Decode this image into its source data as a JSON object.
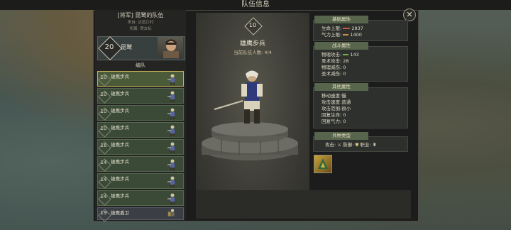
{
  "window": {
    "title": "队伍信息"
  },
  "team": {
    "name": "[将军] 昆鹫的队伍",
    "origin": "来自: 达道口村",
    "belongs": "所属: 鸢去标"
  },
  "leader": {
    "level": "20",
    "name": "昆鹫"
  },
  "formation_label": "编队",
  "units": [
    {
      "level": "10",
      "name": "雄鹰步兵"
    },
    {
      "level": "10",
      "name": "雄鹰步兵"
    },
    {
      "level": "10",
      "name": "雄鹰步兵"
    },
    {
      "level": "10",
      "name": "雄鹰步兵"
    },
    {
      "level": "16",
      "name": "雄鹰步兵"
    },
    {
      "level": "14",
      "name": "雄鹰步兵"
    },
    {
      "level": "14",
      "name": "雄鹰步兵"
    },
    {
      "level": "14",
      "name": "雄鹰步兵"
    },
    {
      "level": "19",
      "name": "雄鹰盾卫"
    }
  ],
  "selected_unit": {
    "level": "10",
    "name": "雄鹰步兵",
    "count": "当前队伍人数: 4/4"
  },
  "basic": {
    "header": "基础属性",
    "hp_label": "生命上限",
    "hp_value": "2837",
    "qi_label": "气力上限",
    "qi_value": "1400"
  },
  "combat": {
    "header": "战斗属性",
    "lines": [
      {
        "label": "物理攻击",
        "value": "143"
      },
      {
        "label": "圣术攻击",
        "value": "28"
      },
      {
        "label": "物理减伤",
        "value": "0"
      },
      {
        "label": "圣术减伤",
        "value": "0"
      }
    ]
  },
  "other": {
    "header": "其他属性",
    "lines": [
      {
        "label": "移动速度",
        "value": "慢"
      },
      {
        "label": "攻击速度",
        "value": "普通"
      },
      {
        "label": "攻击范围",
        "value": "很小"
      },
      {
        "label": "回复生命",
        "value": "0"
      },
      {
        "label": "回复气力",
        "value": "0"
      }
    ]
  },
  "traits": {
    "header": "兵种类型",
    "attack_label": "攻击:",
    "defense_label": "防御:",
    "job_label": "职业:"
  },
  "colors": {
    "accent": "#56654c",
    "selected_border": "#c7b35a"
  },
  "icons": [
    "close-icon",
    "sword-icon",
    "shield-icon",
    "job-icon",
    "skill-icon"
  ]
}
